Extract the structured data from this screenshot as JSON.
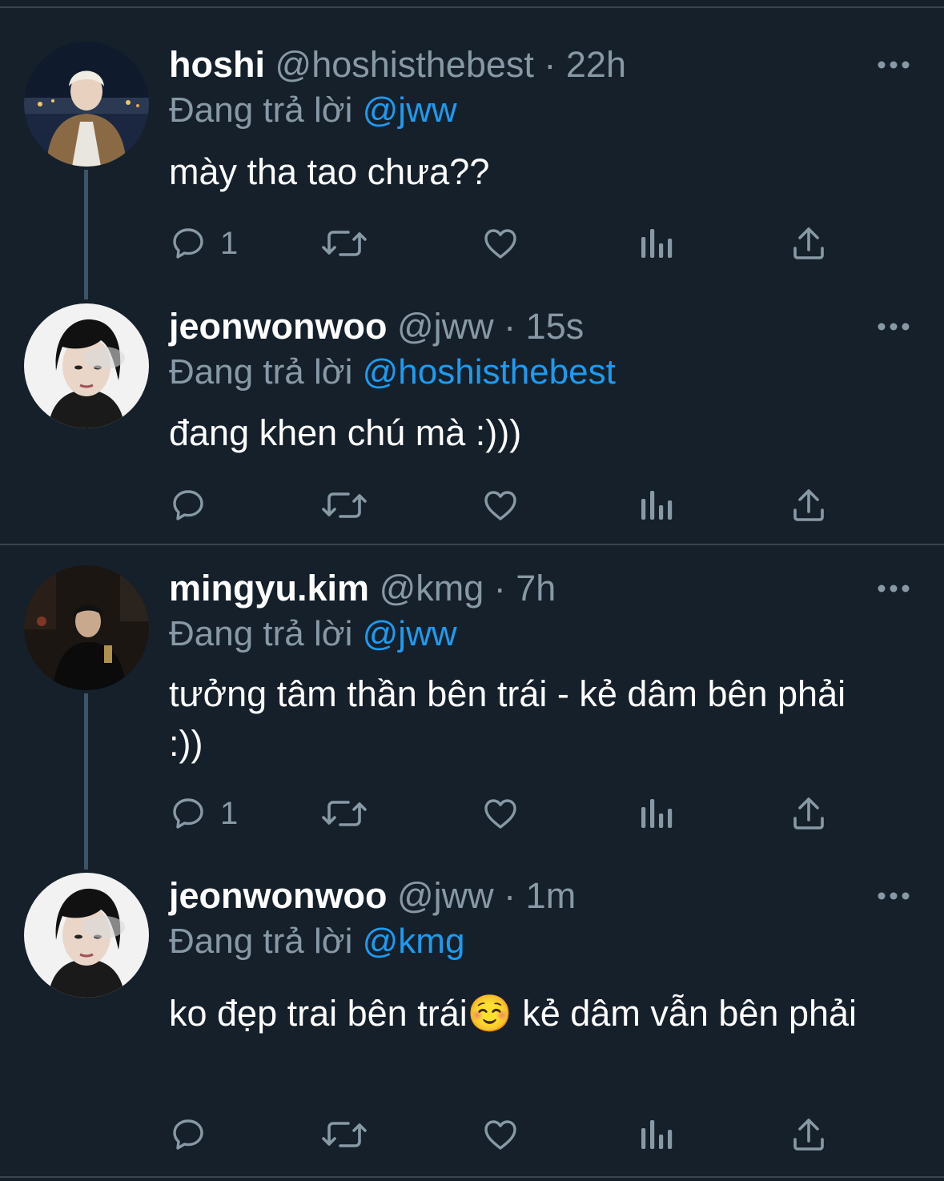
{
  "reply_prefix": "Đang trả lời",
  "tweets": [
    {
      "display_name": "hoshi",
      "handle": "@hoshisthebest",
      "time": "22h",
      "reply_to": "@jww",
      "text": "mày tha tao chưa??",
      "reply_count": "1"
    },
    {
      "display_name": "jeonwonwoo",
      "handle": "@jww",
      "time": "15s",
      "reply_to": "@hoshisthebest",
      "text": "đang khen chú mà :)))",
      "reply_count": ""
    },
    {
      "display_name": "mingyu.kim",
      "handle": "@kmg",
      "time": "7h",
      "reply_to": "@jww",
      "text": "tưởng tâm thần bên trái - kẻ dâm bên phải :))",
      "reply_count": "1"
    },
    {
      "display_name": "jeonwonwoo",
      "handle": "@jww",
      "time": "1m",
      "reply_to": "@kmg",
      "text": "ko đẹp trai bên trái☺️  kẻ dâm vẫn bên phải",
      "reply_count": ""
    }
  ],
  "separator": " · ",
  "colors": {
    "background": "#15202b",
    "divider": "#38444d",
    "secondary_text": "#8899a6",
    "mention": "#1d9bf0",
    "primary_text": "#ffffff"
  },
  "icons": [
    "reply-icon",
    "retweet-icon",
    "like-icon",
    "analytics-icon",
    "share-icon",
    "more-icon"
  ]
}
